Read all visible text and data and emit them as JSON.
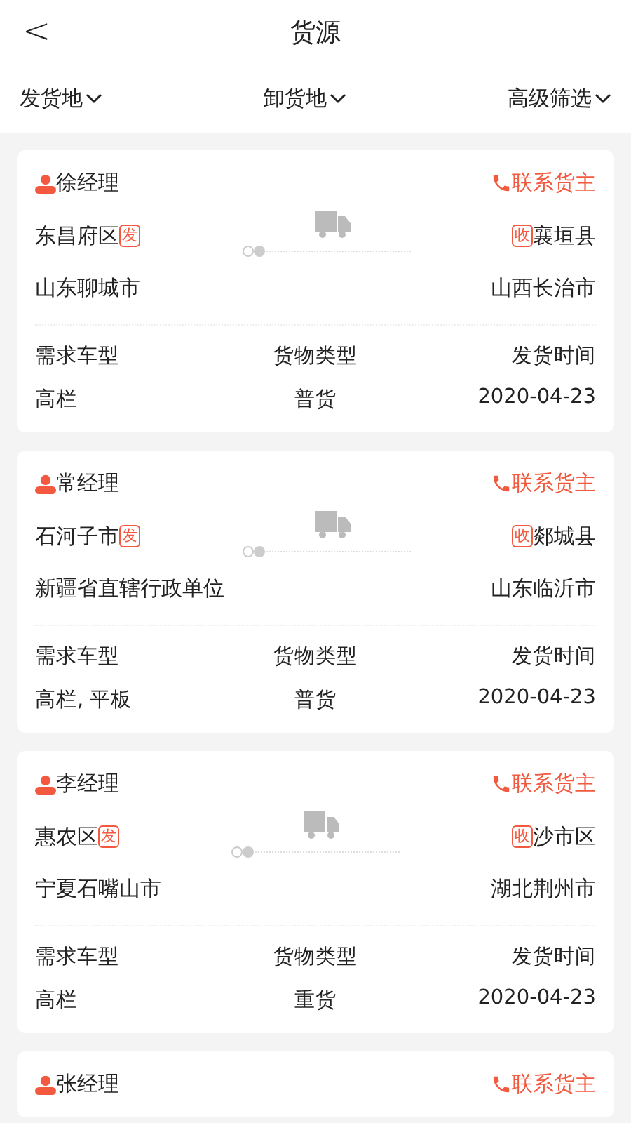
{
  "header": {
    "back": "<",
    "title": "货源"
  },
  "filters": [
    {
      "label": "发货地"
    },
    {
      "label": "卸货地"
    },
    {
      "label": "高级筛选"
    }
  ],
  "cards": [
    {
      "contact": "徐经理",
      "call": "联系货主",
      "from": {
        "district": "东昌府区",
        "tag": "发",
        "city": "山东聊城市"
      },
      "to": {
        "district": "襄垣县",
        "tag": "收",
        "city": "山西长治市"
      },
      "info": [
        {
          "label": "需求车型",
          "value": "高栏"
        },
        {
          "label": "货物类型",
          "value": "普货"
        },
        {
          "label": "发货时间",
          "value": "2020-04-23"
        }
      ]
    },
    {
      "contact": "常经理",
      "call": "联系货主",
      "from": {
        "district": "石河子市",
        "tag": "发",
        "city": "新疆省直辖行政单位"
      },
      "to": {
        "district": "郯城县",
        "tag": "收",
        "city": "山东临沂市"
      },
      "info": [
        {
          "label": "需求车型",
          "value": "高栏, 平板"
        },
        {
          "label": "货物类型",
          "value": "普货"
        },
        {
          "label": "发货时间",
          "value": "2020-04-23"
        }
      ]
    },
    {
      "contact": "李经理",
      "call": "联系货主",
      "from": {
        "district": "惠农区",
        "tag": "发",
        "city": "宁夏石嘴山市"
      },
      "to": {
        "district": "沙市区",
        "tag": "收",
        "city": "湖北荆州市"
      },
      "info": [
        {
          "label": "需求车型",
          "value": "高栏"
        },
        {
          "label": "货物类型",
          "value": "重货"
        },
        {
          "label": "发货时间",
          "value": "2020-04-23"
        }
      ]
    },
    {
      "contact": "张经理",
      "call": "联系货主"
    }
  ]
}
